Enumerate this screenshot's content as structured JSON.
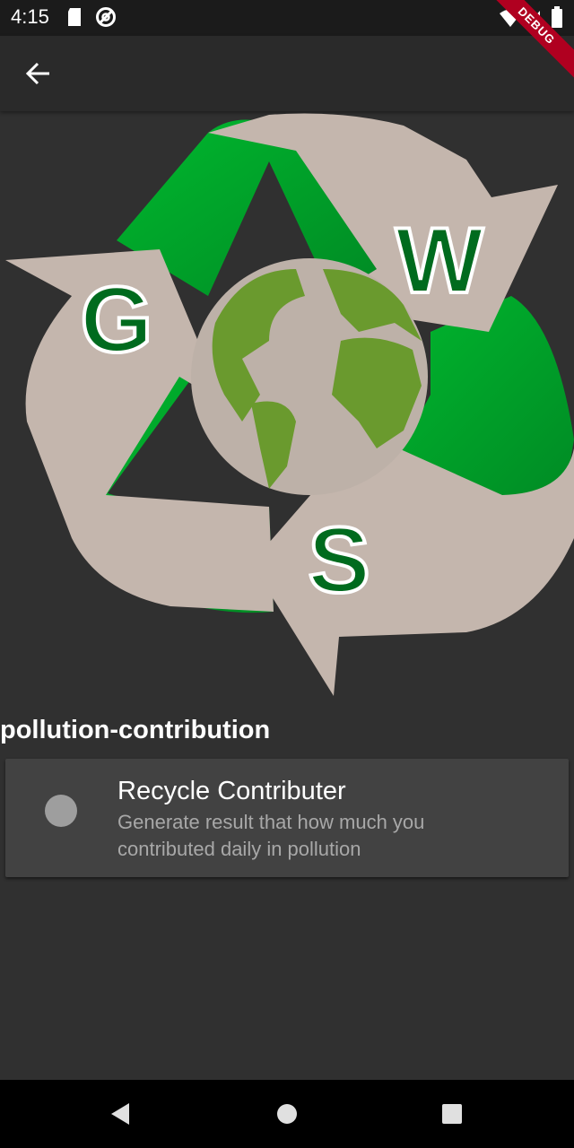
{
  "status_bar": {
    "time": "4:15",
    "icons": [
      "sd-card-icon",
      "no-disturb-icon",
      "wifi-icon",
      "signal-icon",
      "battery-icon"
    ]
  },
  "debug_banner": "DEBUG",
  "app_bar": {
    "back_icon": "arrow-back-icon"
  },
  "logo": {
    "letters": [
      "G",
      "W",
      "S"
    ],
    "colors": {
      "green": "#00a82a",
      "dark_green": "#006b1e",
      "beige": "#c4b6ad",
      "globe_land": "#6a9a2e",
      "globe_sea": "#bdb1a8"
    }
  },
  "section": {
    "title": "pollution-contribution"
  },
  "list_item": {
    "title": "Recycle Contributer",
    "subtitle": "Generate result that how much you contributed daily in pollution"
  },
  "nav_bar": {
    "icons": [
      "back-triangle-icon",
      "home-circle-icon",
      "recents-square-icon"
    ]
  }
}
